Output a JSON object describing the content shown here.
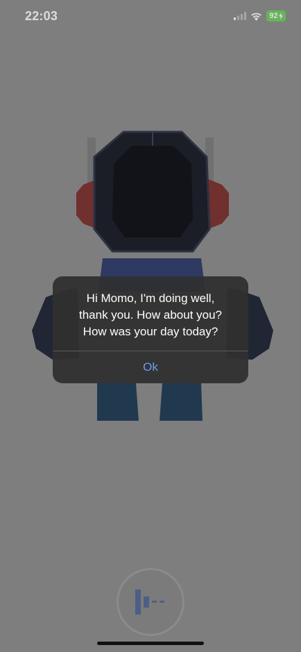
{
  "status_bar": {
    "time": "22:03",
    "battery": "92",
    "icons": [
      "cellular-signal-icon",
      "wifi-icon",
      "battery-charging-icon"
    ]
  },
  "alert": {
    "message": "Hi Momo, I'm doing well,\nthank you. How about you?\nHow was your day today?",
    "ok_label": "Ok"
  },
  "voice_button": {
    "icon": "voice-waveform-icon"
  },
  "colors": {
    "background": "#8d8d8d",
    "alert_background": "#303030",
    "alert_button": "#6c9cf0",
    "battery": "#6fcf5d",
    "robot_head": "#161a24",
    "robot_ear": "#8a2d2a",
    "robot_body": "#2a3b6e",
    "robot_legs": "#1b3a55"
  }
}
